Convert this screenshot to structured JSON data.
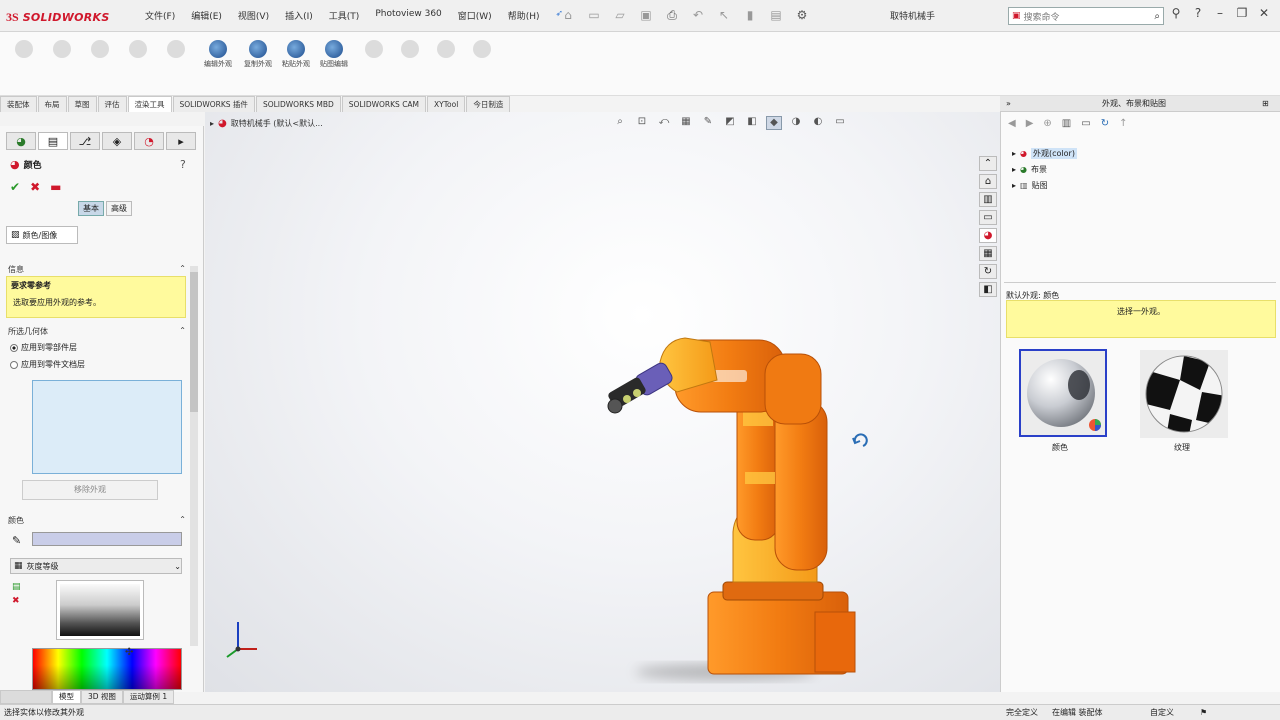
{
  "app": {
    "logo_mark": "3S",
    "logo_text": "SOLIDWORKS",
    "doc_title": "取特机械手",
    "search_placeholder": "搜索命令"
  },
  "menu": [
    "文件(F)",
    "编辑(E)",
    "视图(V)",
    "插入(I)",
    "工具(T)",
    "Photoview 360",
    "窗口(W)",
    "帮助(H)"
  ],
  "command_manager": {
    "active_tools": [
      {
        "label": "编辑外观"
      },
      {
        "label": "复制外观"
      },
      {
        "label": "粘贴外观"
      },
      {
        "label": "贴图编辑"
      }
    ]
  },
  "tabs": [
    "装配体",
    "布局",
    "草图",
    "评估",
    "渲染工具",
    "SOLIDWORKS 插件",
    "SOLIDWORKS MBD",
    "SOLIDWORKS CAM",
    "XYTool",
    "今日制造"
  ],
  "active_tab_index": 4,
  "property_manager": {
    "title": "颜色",
    "basic_btn": "基本",
    "advanced_btn": "高级",
    "tab_label": "颜色/图像",
    "info_header": "信息",
    "info_title": "要求零参考",
    "info_text": "选取要应用外观的参考。",
    "geometry_header": "所选几何体",
    "radio_apply_part": "应用到零部件层",
    "radio_apply_doc": "应用到零件文档层",
    "remove_btn": "移除外观",
    "color_header": "颜色",
    "color_mode": "灰度等级"
  },
  "viewport": {
    "breadcrumb": "取特机械手 (默认<默认..."
  },
  "task_pane": {
    "title": "外观、布景和贴图",
    "tree": [
      "外观(color)",
      "布景",
      "贴图"
    ],
    "info_label": "默认外观: 颜色",
    "info_hint": "选择一外观。",
    "thumbs": [
      {
        "label": "颜色"
      },
      {
        "label": "纹理"
      }
    ]
  },
  "bottom_tabs": [
    "模型",
    "3D 视图",
    "运动算例 1"
  ],
  "status": {
    "left": "选择实体以修改其外观",
    "right_1": "完全定义",
    "right_2": "在编辑 装配体",
    "right_3": "自定义"
  },
  "colors": {
    "robot_orange": "#f07a12",
    "robot_yellow": "#ffb020",
    "info_yellow": "#fffa9d",
    "logo_red": "#d0182c"
  }
}
